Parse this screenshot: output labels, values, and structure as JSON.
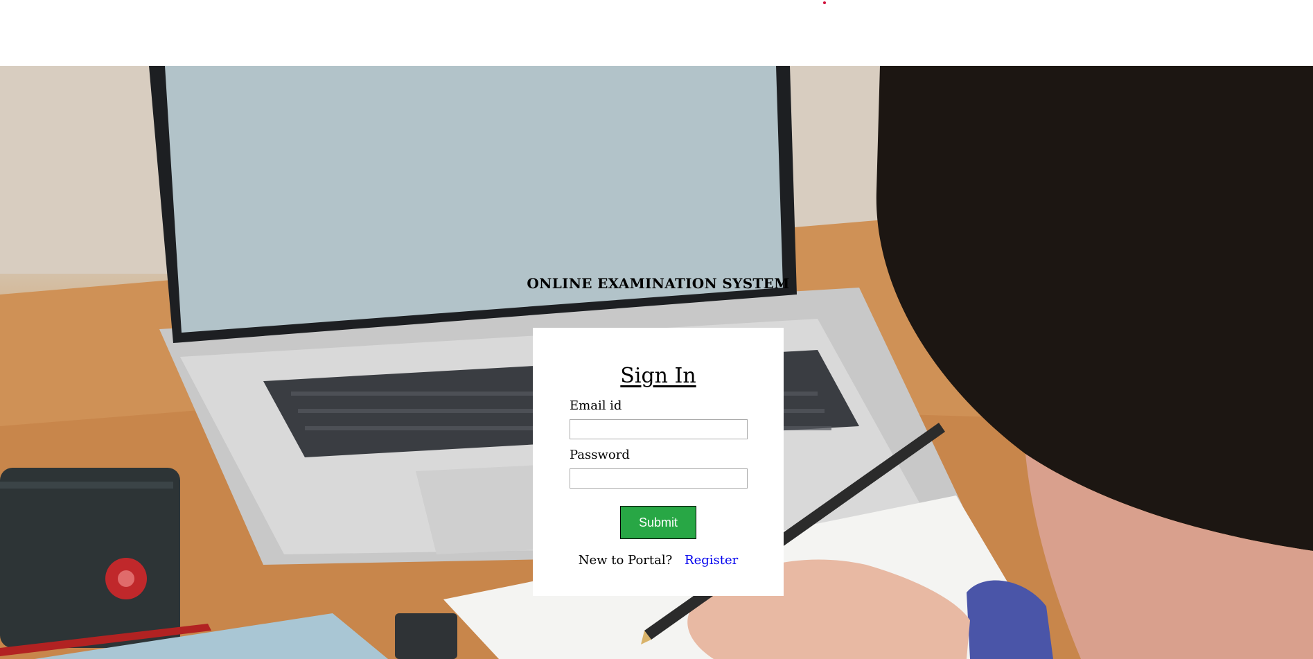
{
  "header": {
    "accent_color": "#d0103a"
  },
  "hero": {
    "title": "ONLINE EXAMINATION SYSTEM",
    "background_description_icon": "laptop-desk-photo"
  },
  "signin": {
    "heading": "Sign In",
    "email_label": "Email id",
    "email_value": "",
    "password_label": "Password",
    "password_value": "",
    "submit_label": "Submit",
    "submit_color": "#28a745",
    "register_prompt": "New to Portal?",
    "register_link": "Register",
    "register_link_color": "#0000ee"
  }
}
